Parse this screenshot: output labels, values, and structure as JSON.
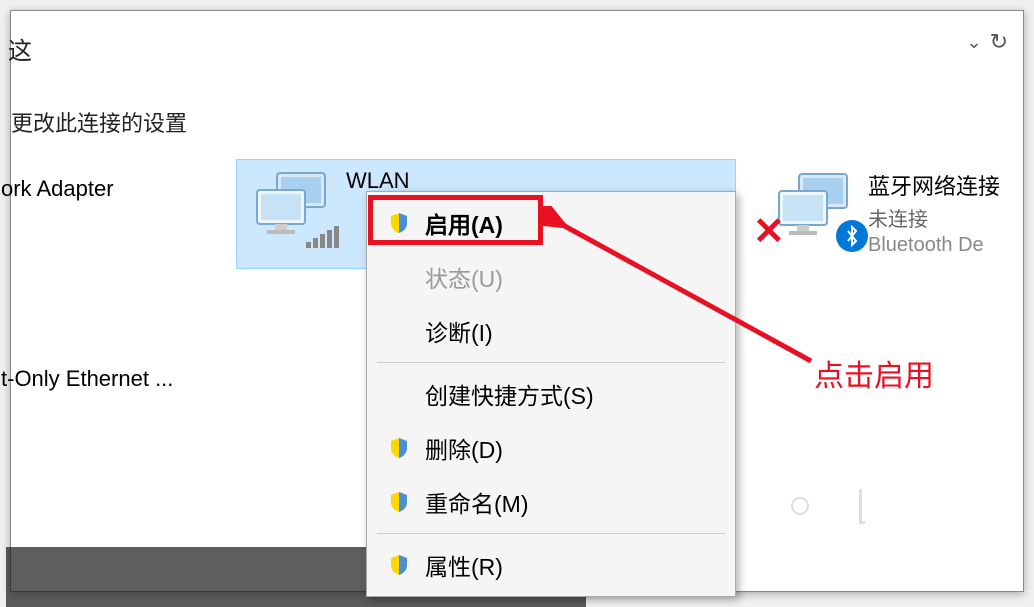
{
  "partial_text_top": "这",
  "toolbar": {
    "dropdown": "⌄",
    "refresh": "↻"
  },
  "section_label": "更改此连接的设置",
  "adapters": {
    "ork": {
      "name": "ork Adapter"
    },
    "wlan": {
      "name": "WLAN"
    },
    "bluetooth": {
      "name": "蓝牙网络连接",
      "status": "未连接",
      "device": "Bluetooth De"
    },
    "ethernet": {
      "name": "t-Only Ethernet ..."
    }
  },
  "context_menu": {
    "enable": "启用(A)",
    "status": "状态(U)",
    "diagnose": "诊断(I)",
    "shortcut": "创建快捷方式(S)",
    "delete": "删除(D)",
    "rename": "重命名(M)",
    "properties": "属性(R)"
  },
  "annotation": "点击启用"
}
